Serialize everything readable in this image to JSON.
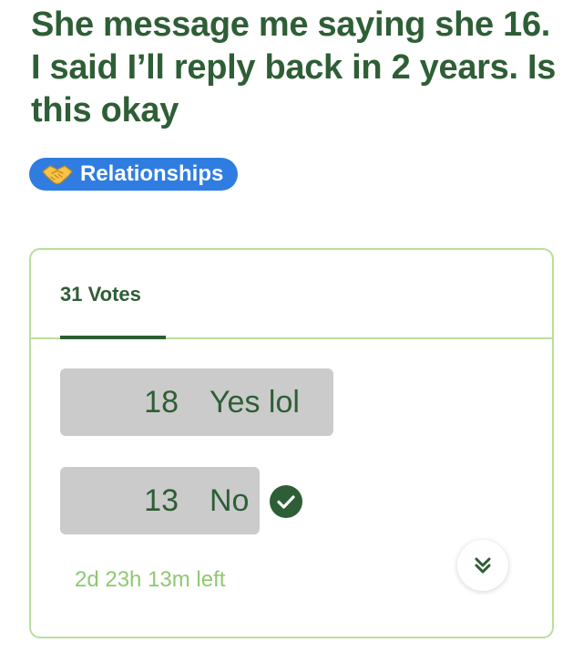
{
  "post": {
    "title": "She message me saying she 16. I said I’ll reply back in 2 years. Is this okay"
  },
  "tag": {
    "label": "Relationships",
    "icon": "handshake-icon",
    "color": "#2f7de1"
  },
  "poll": {
    "votes_tab_label": "31 Votes",
    "options": [
      {
        "count": "18",
        "label": "Yes lol",
        "share": 0.58,
        "selected": false
      },
      {
        "count": "13",
        "label": "No",
        "share": 0.42,
        "selected": true
      }
    ],
    "time_left": "2d 23h 13m left",
    "expand_icon": "double-chevron-down-icon",
    "accent_color": "#2e5e35",
    "border_color": "#b9df9a"
  }
}
